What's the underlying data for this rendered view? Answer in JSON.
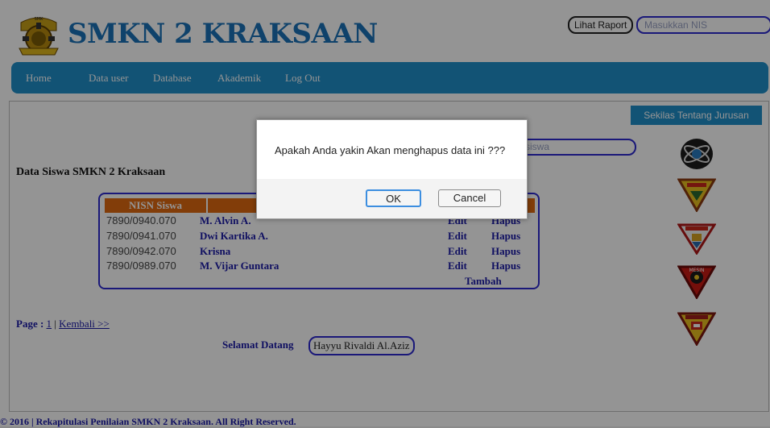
{
  "header": {
    "school_name": "SMKN 2 KRAKSAAN",
    "report_button": "Lihat Raport",
    "nis_placeholder": "Masukkan NIS"
  },
  "nav": {
    "items": [
      "Home",
      "Data user",
      "Database",
      "Akademik",
      "Log Out"
    ]
  },
  "content": {
    "search_placeholder_fragment": "siswa",
    "section_title": "Data Siswa SMKN 2 Kraksaan",
    "table": {
      "headers": [
        "NISN Siswa"
      ],
      "rows": [
        {
          "nisn": "7890/0940.070",
          "name": "M. Alvin A.",
          "edit": "Edit",
          "delete": "Hapus"
        },
        {
          "nisn": "7890/0941.070",
          "name": "Dwi Kartika A.",
          "edit": "Edit",
          "delete": "Hapus"
        },
        {
          "nisn": "7890/0942.070",
          "name": "Krisna",
          "edit": "Edit",
          "delete": "Hapus"
        },
        {
          "nisn": "7890/0989.070",
          "name": "M. Vijar Guntara",
          "edit": "Edit",
          "delete": "Hapus"
        }
      ],
      "add_label": "Tambah"
    },
    "pager": {
      "label": "Page :",
      "current": "1",
      "separator": "|",
      "back": "Kembali >>"
    },
    "welcome": {
      "label": "Selamat Datang",
      "user": "Hayyu Rivaldi Al.Aziz"
    }
  },
  "sidebar": {
    "about_button": "Sekilas Tentang Jurusan",
    "department_icons": [
      "multimedia-logo-icon",
      "electronics-dept-shield-icon",
      "building-dept-shield-icon",
      "machine-dept-shield-icon",
      "fashion-dept-shield-icon"
    ]
  },
  "footer": {
    "text": "© 2016 | Rekapitulasi Penilaian SMKN 2 Kraksaan. All Right Reserved."
  },
  "dialog": {
    "message": "Apakah Anda yakin Akan menghapus data ini ???",
    "ok_label": "OK",
    "cancel_label": "Cancel"
  },
  "colors": {
    "brand_blue": "#1f8fca",
    "title_blue": "#1a72b8",
    "link_blue": "#1b1aa8",
    "table_header_orange": "#e06a10"
  }
}
